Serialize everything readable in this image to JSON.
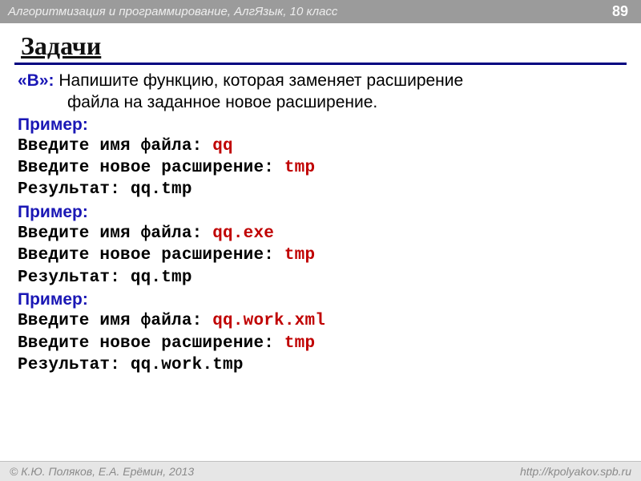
{
  "header": {
    "title": "Алгоритмизация и программирование, АлгЯзык, 10 класс",
    "page_number": "89"
  },
  "title": "Задачи",
  "task": {
    "level_label": "«B»:",
    "desc_line1": " Напишите функцию, которая заменяет расширение",
    "desc_line2": "файла на заданное новое расширение."
  },
  "example_label": "Пример",
  "prompts": {
    "filename_prompt": "Введите имя файла: ",
    "ext_prompt": "Введите новое расширение: ",
    "result_prompt": "Результат: "
  },
  "examples": [
    {
      "filename_input": "qq",
      "ext_input": "tmp",
      "result": "qq.tmp"
    },
    {
      "filename_input": "qq.exe",
      "ext_input": "tmp",
      "result": "qq.tmp"
    },
    {
      "filename_input": "qq.work.xml",
      "ext_input": "tmp",
      "result": "qq.work.tmp"
    }
  ],
  "footer": {
    "left": "© К.Ю. Поляков, Е.А. Ерёмин, 2013",
    "right": "http://kpolyakov.spb.ru"
  }
}
